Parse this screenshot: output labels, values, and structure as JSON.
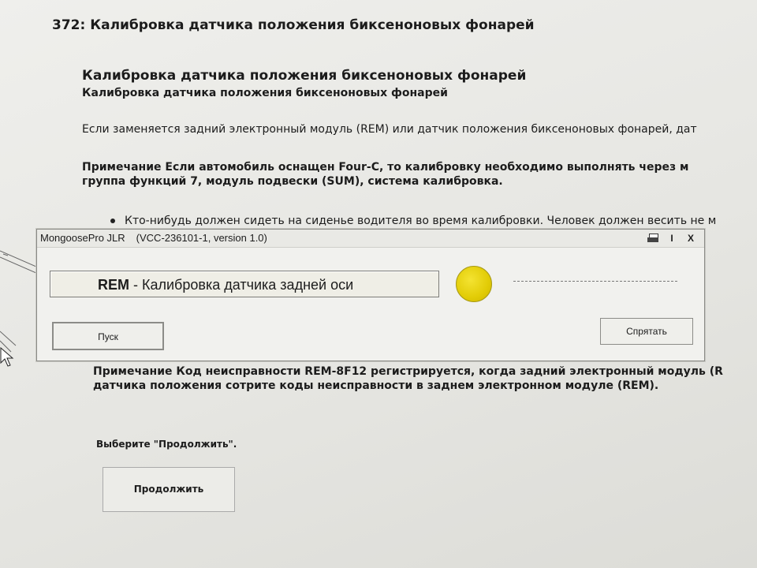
{
  "page": {
    "title": "372: Калибровка датчика положения биксеноновых фонарей",
    "section_title": "Калибровка датчика положения биксеноновых фонарей",
    "section_subtitle": "Калибровка датчика положения биксеноновых фонарей",
    "paragraph": "Если заменяется задний электронный модуль (REM) или датчик положения биксеноновых фонарей, дат",
    "note_lines": [
      "Примечание Если автомобиль оснащен Four-C, то калибровку необходимо выполнять через м",
      "группа функций 7, модуль подвески (SUM), система калибровка."
    ],
    "bullet": "Кто-нибудь должен сидеть на сиденье водителя во время калибровки. Человек должен весить не м",
    "note2_lines": [
      "Примечание Код неисправности REM-8F12 регистрируется, когда задний электронный модуль (R",
      "датчика положения сотрите коды неисправности в заднем электронном модуле (REM)."
    ],
    "select_text": "Выберите \"Продолжить\".",
    "continue_label": "Продолжить"
  },
  "dialog": {
    "app_name": "MongoosePro JLR",
    "version": "(VCC-236101-1, version 1.0)",
    "controls": {
      "print_icon": "printer-icon",
      "info": "I",
      "close": "X"
    },
    "status_prefix": "REM",
    "status_text": " - Калибровка датчика задней оси",
    "indicator_color": "#e2cc06",
    "start_label": "Пуск",
    "hide_label": "Спрятать"
  }
}
